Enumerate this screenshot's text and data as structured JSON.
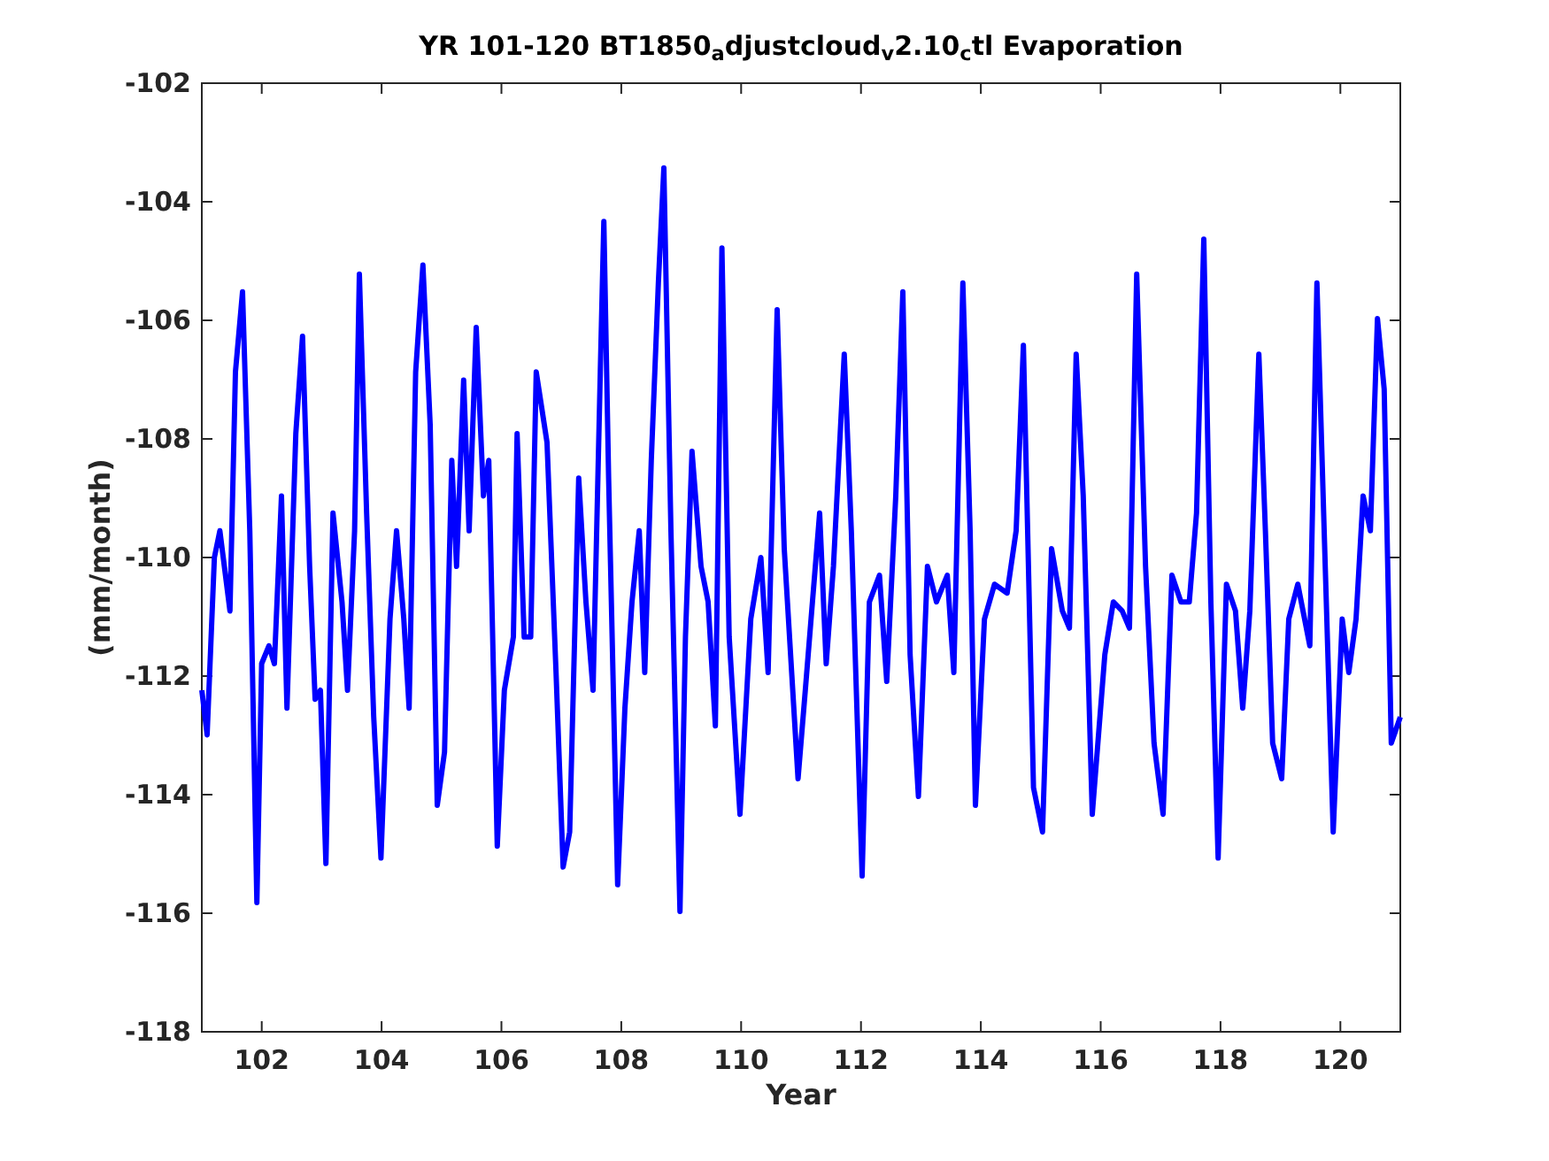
{
  "chart_data": {
    "type": "line",
    "title": "YR 101-120 BT1850$_{a}$djustcloud$_{v}$2.10$_{c}$tl Evaporation",
    "xlabel": "Year",
    "ylabel": "(mm/month)",
    "xlim": [
      101,
      121
    ],
    "ylim": [
      -118,
      -102
    ],
    "xticks": [
      102,
      104,
      106,
      108,
      110,
      112,
      114,
      116,
      118,
      120
    ],
    "yticks": [
      -118,
      -116,
      -114,
      -112,
      -110,
      -108,
      -106,
      -104,
      -102
    ],
    "x": [
      101.0,
      101.09,
      101.21,
      101.3,
      101.47,
      101.56,
      101.68,
      101.8,
      101.92,
      102.0,
      102.12,
      102.21,
      102.33,
      102.42,
      102.57,
      102.68,
      102.8,
      102.89,
      102.98,
      103.07,
      103.19,
      103.34,
      103.43,
      103.55,
      103.63,
      103.75,
      103.87,
      103.99,
      104.14,
      104.25,
      104.37,
      104.46,
      104.57,
      104.69,
      104.81,
      104.93,
      105.05,
      105.17,
      105.25,
      105.37,
      105.46,
      105.58,
      105.7,
      105.79,
      105.93,
      106.05,
      106.2,
      106.26,
      106.38,
      106.49,
      106.58,
      106.76,
      106.91,
      107.03,
      107.14,
      107.29,
      107.41,
      107.53,
      107.65,
      107.71,
      107.79,
      107.94,
      108.06,
      108.18,
      108.3,
      108.39,
      108.5,
      108.62,
      108.71,
      108.83,
      108.98,
      109.07,
      109.18,
      109.33,
      109.45,
      109.57,
      109.68,
      109.8,
      109.98,
      110.16,
      110.33,
      110.45,
      110.6,
      110.72,
      110.95,
      111.07,
      111.31,
      111.42,
      111.54,
      111.72,
      111.84,
      112.02,
      112.14,
      112.31,
      112.43,
      112.58,
      112.7,
      112.82,
      112.96,
      113.11,
      113.26,
      113.44,
      113.55,
      113.7,
      113.82,
      113.91,
      114.06,
      114.23,
      114.44,
      114.59,
      114.71,
      114.88,
      115.03,
      115.18,
      115.36,
      115.48,
      115.59,
      115.71,
      115.86,
      116.07,
      116.21,
      116.36,
      116.48,
      116.6,
      116.75,
      116.89,
      117.04,
      117.19,
      117.34,
      117.48,
      117.6,
      117.72,
      117.84,
      117.96,
      118.1,
      118.25,
      118.37,
      118.49,
      118.64,
      118.75,
      118.87,
      119.02,
      119.14,
      119.29,
      119.49,
      119.61,
      119.73,
      119.88,
      120.03,
      120.14,
      120.26,
      120.38,
      120.5,
      120.62,
      120.73,
      120.85,
      121.0
    ],
    "series": [
      {
        "color": "#0000ff",
        "values": [
          -112.24,
          -112.99,
          -110.0,
          -109.55,
          -110.9,
          -106.87,
          -105.52,
          -109.55,
          -115.82,
          -111.79,
          -111.49,
          -111.79,
          -108.96,
          -112.54,
          -107.91,
          -106.27,
          -110.15,
          -112.39,
          -112.24,
          -115.16,
          -109.25,
          -110.75,
          -112.24,
          -109.55,
          -105.22,
          -109.25,
          -112.69,
          -115.07,
          -111.04,
          -109.55,
          -111.04,
          -112.54,
          -106.87,
          -105.07,
          -107.76,
          -114.18,
          -113.28,
          -108.36,
          -110.15,
          -107.01,
          -109.55,
          -106.12,
          -108.96,
          -108.36,
          -114.87,
          -112.24,
          -111.34,
          -107.91,
          -111.34,
          -111.34,
          -106.87,
          -108.06,
          -111.94,
          -115.22,
          -114.63,
          -108.66,
          -110.75,
          -112.24,
          -106.87,
          -104.33,
          -108.66,
          -115.52,
          -112.54,
          -110.75,
          -109.55,
          -111.94,
          -108.36,
          -105.37,
          -103.43,
          -109.55,
          -115.97,
          -111.34,
          -108.21,
          -110.15,
          -110.75,
          -112.84,
          -104.78,
          -111.34,
          -114.33,
          -111.04,
          -110.0,
          -111.94,
          -105.82,
          -109.85,
          -113.73,
          -112.24,
          -109.25,
          -111.79,
          -110.15,
          -106.57,
          -109.55,
          -115.37,
          -110.75,
          -110.3,
          -112.09,
          -108.96,
          -105.52,
          -111.64,
          -114.03,
          -110.15,
          -110.75,
          -110.3,
          -111.94,
          -105.37,
          -109.55,
          -114.18,
          -111.04,
          -110.45,
          -110.6,
          -109.55,
          -106.42,
          -113.88,
          -114.63,
          -109.85,
          -110.9,
          -111.19,
          -106.57,
          -108.96,
          -114.33,
          -111.64,
          -110.75,
          -110.9,
          -111.19,
          -105.22,
          -110.15,
          -113.13,
          -114.33,
          -110.3,
          -110.75,
          -110.75,
          -109.25,
          -104.63,
          -110.75,
          -115.07,
          -110.45,
          -110.9,
          -112.54,
          -110.9,
          -106.57,
          -109.55,
          -113.13,
          -113.73,
          -111.04,
          -110.45,
          -111.49,
          -105.37,
          -109.55,
          -114.63,
          -111.04,
          -111.94,
          -111.04,
          -108.96,
          -109.55,
          -105.97,
          -107.16,
          -113.13,
          -112.69
        ]
      }
    ]
  }
}
